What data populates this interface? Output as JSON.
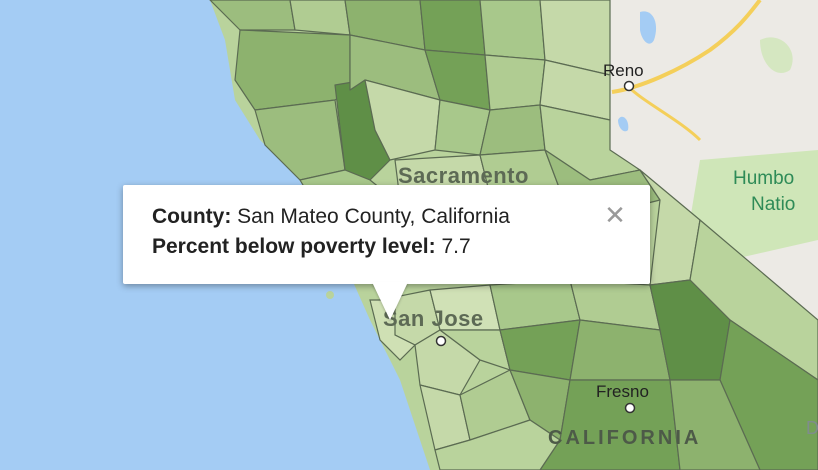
{
  "map": {
    "colors": {
      "water": "#a4ccf4",
      "land_outside": "#eceae5",
      "nevada_park": "#cfe6b8",
      "county_fill_light": "#c5d9a9",
      "county_fill_mid": "#9cbd7e",
      "county_fill_dark": "#74a157",
      "county_fill_darkest": "#5f8f47",
      "county_border": "#5b6b52",
      "highway": "#f4cf5a"
    },
    "labels": {
      "sacramento": "Sacramento",
      "san_jose": "San Jose",
      "fresno": "Fresno",
      "reno": "Reno",
      "california": "CALIFORNIA",
      "park_line1": "Humbo",
      "park_line2": "Natio",
      "partial_edge": "D"
    }
  },
  "tooltip": {
    "county_label": "County:",
    "county_value": "San Mateo County, California",
    "poverty_label": "Percent below poverty level:",
    "poverty_value": "7.7",
    "close_icon": "close-icon"
  }
}
